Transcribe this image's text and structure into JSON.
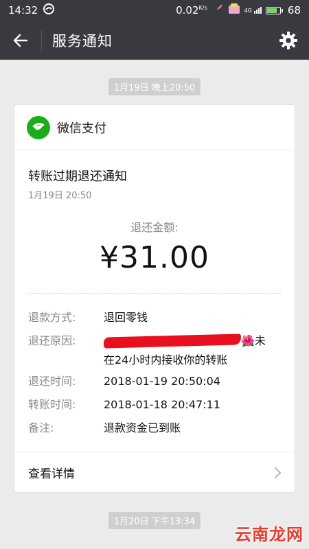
{
  "status_bar": {
    "time": "14:32",
    "speed": "0.02",
    "speed_unit": "K/s",
    "network": "4G",
    "battery": "68"
  },
  "header": {
    "title": "服务通知"
  },
  "messages": [
    {
      "timestamp": "1月19日 晚上20:50",
      "sender": "微信支付",
      "title": "转账过期退还通知",
      "date": "1月19日 20:50",
      "amount_label": "退还金额:",
      "amount": "¥31.00",
      "details": [
        {
          "label": "退款方式:",
          "value": "退回零钱"
        },
        {
          "label": "退还原因:",
          "value_tail": "🌺未",
          "value_line2": "在24小时内接收你的转账"
        },
        {
          "label": "退还时间:",
          "value": "2018-01-19 20:50:04"
        },
        {
          "label": "转账时间:",
          "value": "2018-01-18 20:47:11"
        },
        {
          "label": "备注:",
          "value": "退款资金已到账"
        }
      ],
      "link": "查看详情"
    },
    {
      "timestamp": "1月20日 下午13:34"
    }
  ],
  "watermark": "云南龙网",
  "colors": {
    "header_bg": "#393a3f",
    "pay_green": "#1aad19",
    "redact_red": "#e8101e"
  }
}
